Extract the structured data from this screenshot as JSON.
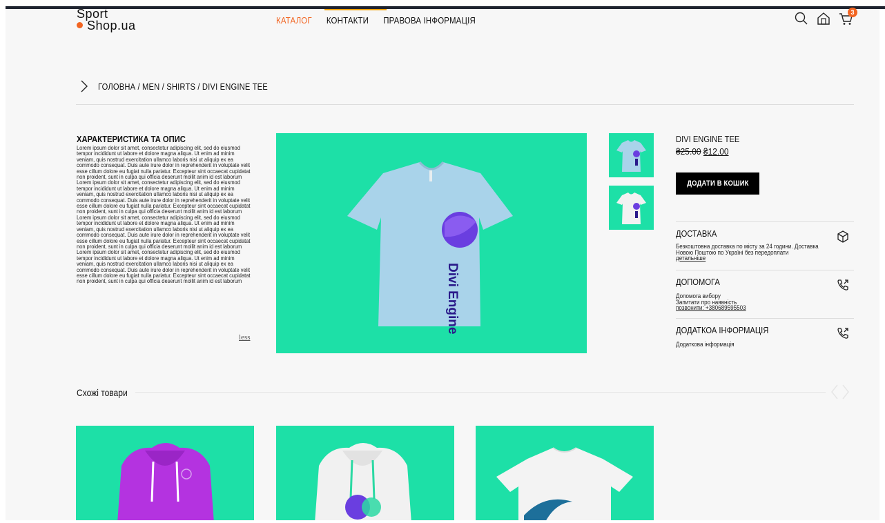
{
  "header": {
    "logo_line1": "Sport",
    "logo_line2": "Shop.ua",
    "nav": [
      "КАТАЛОГ",
      "КОНТАКТИ",
      "ПРАВОВА ІНФОРМАЦІЯ"
    ],
    "cart_count": "3",
    "accent_color": "#f26522"
  },
  "breadcrumb": "ГОЛОВНА / MEN / SHIRTS / DIVI ENGINE TEE",
  "description": {
    "title": "ХАРАКТЕРИСТИКА ТА ОПИС",
    "text": "Lorem ipsum dolor sit amet, consectetur adipiscing elit, sed do eiusmod tempor incididunt ut labore et dolore magna aliqua. Ut enim ad minim veniam, quis nostrud exercitation ullamco laboris nisi ut aliquip ex ea commodo consequat. Duis aute irure dolor in reprehenderit in voluptate velit esse cillum dolore eu fugiat nulla pariatur. Excepteur sint occaecat cupidatat non proident, sunt in culpa qui officia deserunt mollit anim id est laborum Lorem ipsum dolor sit amet, consectetur adipiscing elit, sed do eiusmod tempor incididunt ut labore et dolore magna aliqua. Ut enim ad minim veniam, quis nostrud exercitation ullamco laboris nisi ut aliquip ex ea commodo consequat. Duis aute irure dolor in reprehenderit in voluptate velit esse cillum dolore eu fugiat nulla pariatur. Excepteur sint occaecat cupidatat non proident, sunt in culpa qui officia deserunt mollit anim id est laborum Lorem ipsum dolor sit amet, consectetur adipiscing elit, sed do eiusmod tempor incididunt ut labore et dolore magna aliqua. Ut enim ad minim veniam, quis nostrud exercitation ullamco laboris nisi ut aliquip ex ea commodo consequat. Duis aute irure dolor in reprehenderit in voluptate velit esse cillum dolore eu fugiat nulla pariatur. Excepteur sint occaecat cupidatat non proident, sunt in culpa qui officia deserunt mollit anim id est laborum Lorem ipsum dolor sit amet, consectetur adipiscing elit, sed do eiusmod tempor incididunt ut labore et dolore magna aliqua. Ut enim ad minim veniam, quis nostrud exercitation ullamco laboris nisi ut aliquip ex ea commodo consequat. Duis aute irure dolor in reprehenderit in voluptate velit esse cillum dolore eu fugiat nulla pariatur. Excepteur sint occaecat cupidatat non proident, sunt in culpa qui officia deserunt mollit anim id est laborum",
    "toggle_label": "less"
  },
  "product": {
    "title": "DIVI ENGINE TEE",
    "old_price": "₴25.00",
    "new_price": "₴12.00",
    "add_to_cart": "ДОДАТИ В КОШИК",
    "image_text": "Divi Engine",
    "image_bg": "#1de0a7"
  },
  "info": {
    "delivery": {
      "title": "ДОСТАВКА",
      "text": "Безкоштовна доставка по місту за 24 години. Доставка Новою Поштою по Україні без передоплати",
      "link": "детальніше"
    },
    "help": {
      "title": "ДОПОМОГА",
      "line1": "Допомога вибору",
      "line2": "Запитати про наявність",
      "link": "позвонити: +380689595503"
    },
    "extra": {
      "title": "ДОДАТКОА ІНФОРМАЦІЯ",
      "text": "Додаткова інформація"
    }
  },
  "similar": {
    "title": "Схожі товари"
  }
}
